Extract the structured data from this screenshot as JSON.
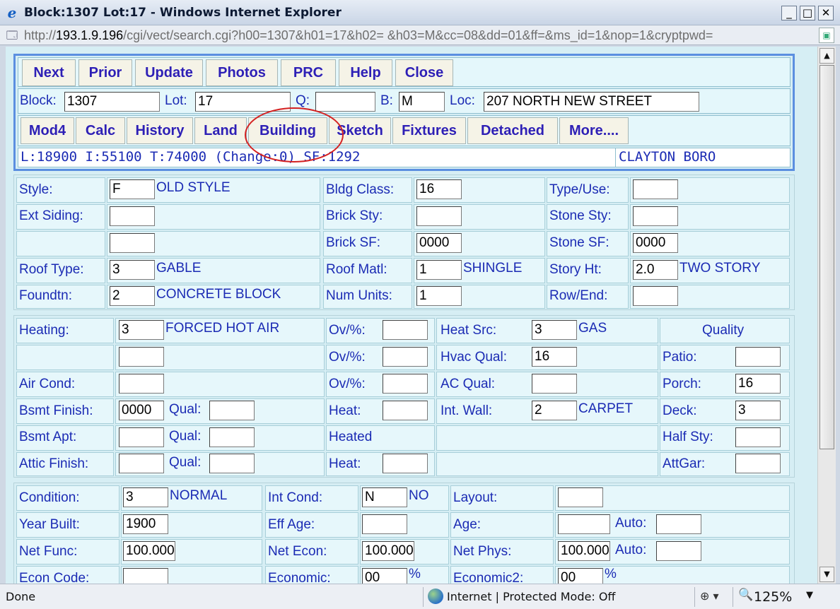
{
  "window": {
    "title": "Block:1307 Lot:17 - Windows Internet Explorer",
    "min": "_",
    "max": "□",
    "close": "✕"
  },
  "address": {
    "prefix": "http://",
    "host": "193.1.9.196",
    "path": "/cgi/vect/search.cgi?h00=1307&h01=17&h02= &h03=M&cc=08&dd=01&ff=&ms_id=1&nop=1&cryptpwd="
  },
  "nav": [
    "Next",
    "Prior",
    "Update",
    "Photos",
    "PRC",
    "Help",
    "Close"
  ],
  "ident": {
    "block_label": "Block:",
    "block": "1307",
    "lot_label": "Lot:",
    "lot": "17",
    "q_label": "Q:",
    "q": "",
    "b_label": "B:",
    "b": "M",
    "loc_label": "Loc:",
    "loc": "207 NORTH NEW STREET"
  },
  "subnav": [
    "Mod4",
    "Calc",
    "History",
    "Land",
    "Building",
    "Sketch",
    "Fixtures",
    "Detached",
    "More...."
  ],
  "summary": {
    "values": "L:18900 I:55100 T:74000 (Change:0) SF:1292",
    "town": "CLAYTON BORO"
  },
  "building": {
    "style_label": "Style:",
    "style": "F",
    "style_desc": "OLD STYLE",
    "bldg_class_label": "Bldg Class:",
    "bldg_class": "16",
    "type_use_label": "Type/Use:",
    "type_use": "",
    "ext_siding_label": "Ext Siding:",
    "ext_siding": "",
    "ext_siding2": "",
    "brick_sty_label": "Brick Sty:",
    "brick_sty": "",
    "stone_sty_label": "Stone Sty:",
    "stone_sty": "",
    "brick_sf_label": "Brick SF:",
    "brick_sf": "0000",
    "stone_sf_label": "Stone SF:",
    "stone_sf": "0000",
    "roof_type_label": "Roof Type:",
    "roof_type": "3",
    "roof_type_desc": "GABLE",
    "roof_matl_label": "Roof Matl:",
    "roof_matl": "1",
    "roof_matl_desc": "SHINGLE",
    "story_ht_label": "Story Ht:",
    "story_ht": "2.0",
    "story_ht_desc": "TWO STORY",
    "foundtn_label": "Foundtn:",
    "foundtn": "2",
    "foundtn_desc": "CONCRETE BLOCK",
    "num_units_label": "Num Units:",
    "num_units": "1",
    "row_end_label": "Row/End:",
    "row_end": ""
  },
  "mech": {
    "heating_label": "Heating:",
    "heating": "3",
    "heating_desc": "FORCED HOT AIR",
    "heating2": "",
    "ov_label": "Ov/%:",
    "ov1": "",
    "ov2": "",
    "ov3": "",
    "heat_src_label": "Heat Src:",
    "heat_src": "3",
    "heat_src_desc": "GAS",
    "hvac_qual_label": "Hvac Qual:",
    "hvac_qual": "16",
    "ac_qual_label": "AC Qual:",
    "ac_qual": "",
    "int_wall_label": "Int. Wall:",
    "int_wall": "2",
    "int_wall_desc": "CARPET",
    "quality_label": "Quality",
    "patio_label": "Patio:",
    "patio": "",
    "porch_label": "Porch:",
    "porch": "16",
    "deck_label": "Deck:",
    "deck": "3",
    "half_sty_label": "Half Sty:",
    "half_sty": "",
    "attgar_label": "AttGar:",
    "attgar": "",
    "air_cond_label": "Air Cond:",
    "air_cond": "",
    "bsmt_finish_label": "Bsmt Finish:",
    "bsmt_finish": "0000",
    "qual_label": "Qual:",
    "bsmt_finish_qual": "",
    "heat_label": "Heat:",
    "heat1": "",
    "heat2": "",
    "bsmt_apt_label": "Bsmt Apt:",
    "bsmt_apt": "",
    "bsmt_apt_qual": "",
    "heated_label": "Heated",
    "attic_label": "Attic Finish:",
    "attic": "",
    "attic_qual": ""
  },
  "cond": {
    "condition_label": "Condition:",
    "condition": "3",
    "condition_desc": "NORMAL",
    "int_cond_label": "Int Cond:",
    "int_cond": "N",
    "int_cond_desc": "NO",
    "layout_label": "Layout:",
    "layout": "",
    "year_built_label": "Year Built:",
    "year_built": "1900",
    "eff_age_label": "Eff Age:",
    "eff_age": "",
    "age_label": "Age:",
    "age": "",
    "auto_label": "Auto:",
    "age_auto": "",
    "net_func_label": "Net Func:",
    "net_func": "100.000",
    "net_econ_label": "Net Econ:",
    "net_econ": "100.000",
    "net_phys_label": "Net Phys:",
    "net_phys": "100.000",
    "phys_auto": "",
    "econ_code_label": "Econ Code:",
    "econ_code": "",
    "economic_label": "Economic:",
    "economic": "00",
    "pct": "%",
    "economic2_label": "Economic2:",
    "economic2": "00"
  },
  "status": {
    "left": "Done",
    "zone": "Internet | Protected Mode: Off",
    "security": "⊕ ▾",
    "zoom": "125%"
  }
}
